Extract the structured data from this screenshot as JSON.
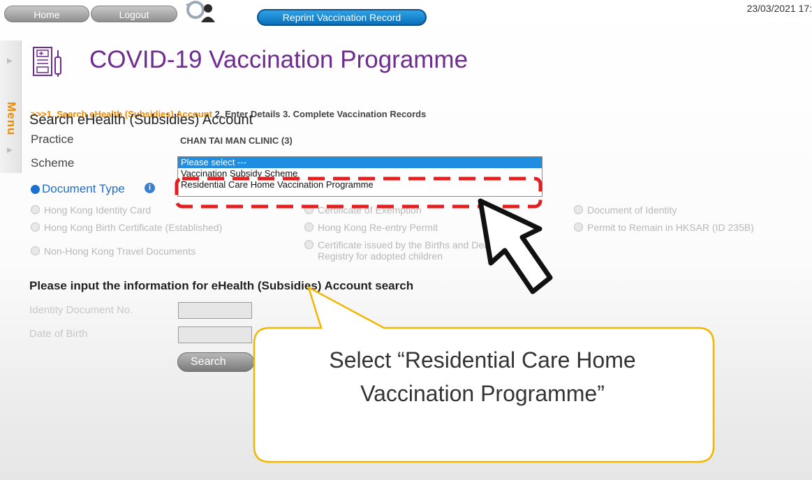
{
  "topnav": {
    "home": "Home",
    "logout": "Logout",
    "reprint": "Reprint Vaccination Record",
    "datetime": "23/03/2021 17:"
  },
  "side_menu": {
    "label": "Menu"
  },
  "title": "COVID-19  Vaccination Programme",
  "steps": {
    "arrows": ">>>",
    "step1": "1. Search eHealth (Subsidies) Account",
    "step2": "2. Enter Details",
    "step3": "3. Complete Vaccination Records"
  },
  "section_title": "Search eHealth (Subsidies) Account",
  "practice": {
    "label": "Practice",
    "value": "CHAN TAI MAN CLINIC (3)"
  },
  "scheme": {
    "label": "Scheme",
    "options": [
      "Please select ---",
      "Vaccination Subsidy Scheme",
      "Residential Care Home Vaccination Programme"
    ],
    "selected_index": 0
  },
  "document_type": {
    "label": "Document Type",
    "info_glyph": "i",
    "options": [
      "Hong Kong Identity Card",
      "Certificate of Exemption",
      "Document of Identity",
      "Hong Kong Birth Certificate (Established)",
      "Hong Kong Re-entry Permit",
      "Permit to Remain in HKSAR (ID 235B)",
      "Non-Hong Kong Travel Documents",
      "Certificate issued by the Births and Deaths\nRegistry for adopted children"
    ]
  },
  "search_form": {
    "heading": "Please input the information for eHealth (Subsidies) Account search",
    "id_label": "Identity Document No.",
    "dob_label": "Date of Birth",
    "search_button": "Search"
  },
  "callout": {
    "line1": "Select “Residential Care Home",
    "line2": "Vaccination Programme”"
  },
  "colors": {
    "title": "#6d2d8f",
    "accent_orange": "#f08b00",
    "highlight_red": "#e41e1e",
    "callout_border": "#f2b600"
  },
  "icons": [
    "refresh-user-icon",
    "medical-record-icon",
    "info-icon",
    "pointer-arrow-icon"
  ]
}
